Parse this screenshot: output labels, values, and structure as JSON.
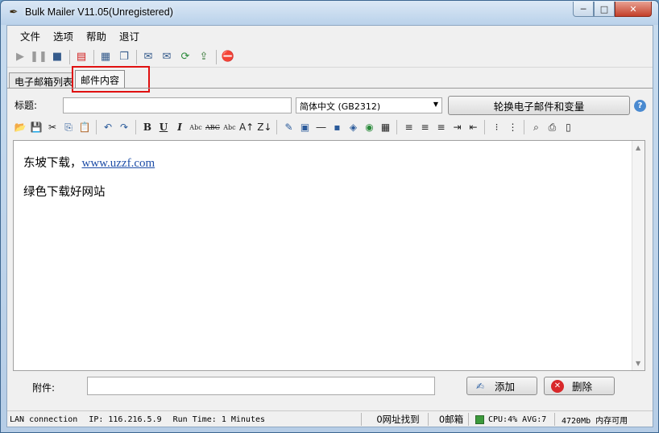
{
  "window": {
    "title": "Bulk Mailer V11.05(Unregistered)",
    "controls": {
      "minimize": "─",
      "maximize": "□",
      "close": "✕"
    }
  },
  "menu": [
    "文件",
    "选项",
    "帮助",
    "退订"
  ],
  "toolbar": {
    "icons": [
      "play-icon",
      "pause-icon",
      "stop-icon",
      "address-book-icon",
      "server-icon",
      "copy-window-icon",
      "send-mail-icon",
      "open-mail-icon",
      "refresh-icon",
      "upload-icon",
      "stop-sign-icon"
    ]
  },
  "tabs": [
    {
      "label": "电子邮箱列表",
      "selected": false
    },
    {
      "label": "邮件内容",
      "selected": true
    }
  ],
  "compose": {
    "subject_label": "标题:",
    "subject_value": "",
    "charset_value": "简体中文 (GB2312)",
    "rotate_button": "轮换电子邮件和变量",
    "help": "?"
  },
  "editor_toolbar": {
    "abc": "Abc",
    "abc_strike": "ABC",
    "abc_small": "Abc",
    "bold": "B",
    "underline": "U",
    "italic": "I"
  },
  "body": {
    "line1_text": "东坡下载，",
    "line1_link": "www.uzzf.com",
    "line2_text": "绿色下载好网站"
  },
  "attachment": {
    "label": "附件:",
    "value": "",
    "add_button": "添加",
    "delete_button": "删除"
  },
  "status": {
    "connection": "LAN connection",
    "ip": "IP: 116.216.5.9",
    "runtime": "Run Time: 1 Minutes",
    "found": "0网址找到",
    "mailbox": "0邮箱",
    "cpu": "CPU:4% AVG:7",
    "memory": "4720Mb 内存可用"
  },
  "colors": {
    "highlight": "#e01010",
    "link": "#1f4ea8",
    "cpu_indicator": "#3c9a3c"
  }
}
